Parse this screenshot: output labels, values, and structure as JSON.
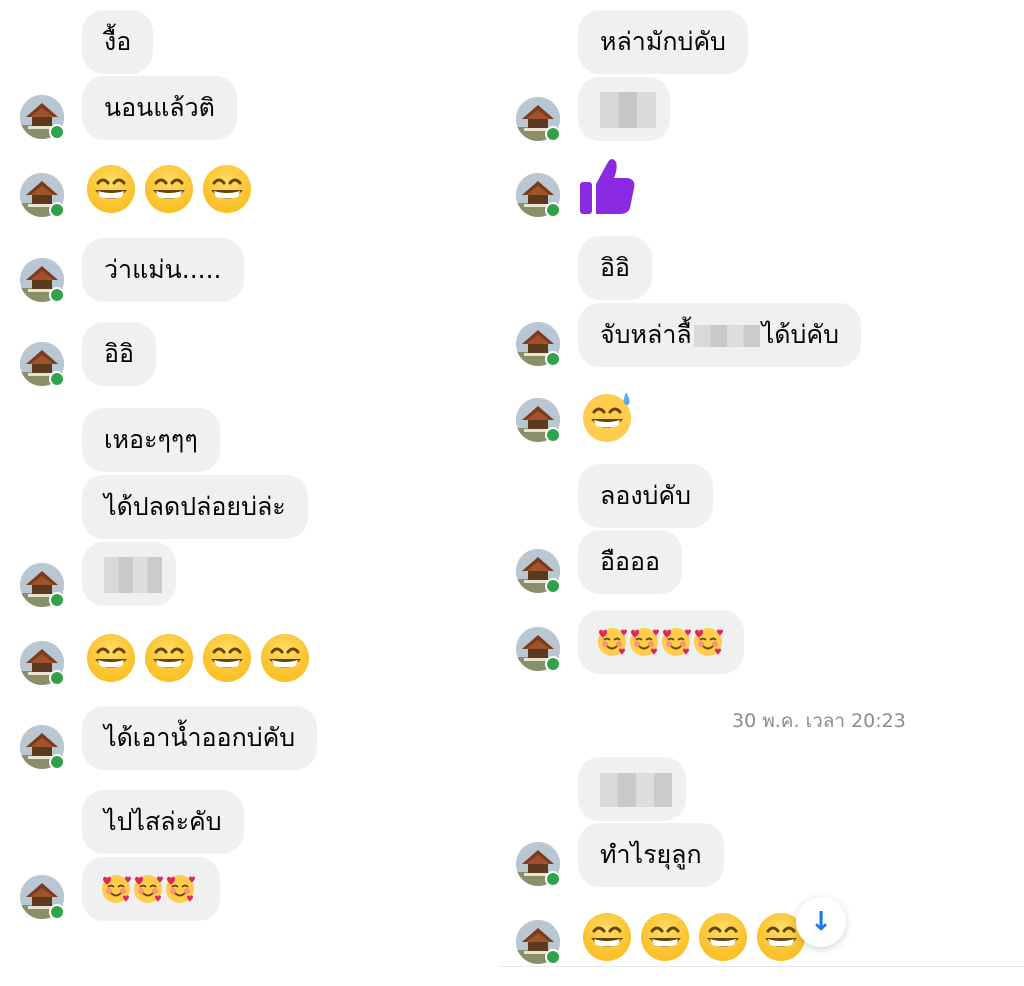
{
  "left": {
    "messages": [
      {
        "text": "งื้อ"
      },
      {
        "text": "นอนแล้วติ"
      },
      {
        "emoji": "grinning-face",
        "count": 3
      },
      {
        "text": "ว่าแม่น....."
      },
      {
        "text": "อิอิ"
      },
      {
        "text": "เหอะๆๆๆ"
      },
      {
        "text": "ได้ปลดปล่อยบ่ล่ะ"
      },
      {
        "redacted": true
      },
      {
        "emoji": "grinning-face",
        "count": 4
      },
      {
        "text": "ได้เอาน้ำออกบ่คับ"
      },
      {
        "text": "ไปไสล่ะคับ"
      },
      {
        "emoji": "smiling-face-with-hearts",
        "count": 3
      }
    ]
  },
  "right": {
    "messages": [
      {
        "text": "หล่ามักบ่คับ"
      },
      {
        "redacted": true
      },
      {
        "emoji": "thumbs-up"
      },
      {
        "text": "อิอิ"
      },
      {
        "text_before": "จับหล่าลื้",
        "text_after": "ได้บ่คับ"
      },
      {
        "emoji": "grinning-face-with-sweat"
      },
      {
        "text": "ลองบ่คับ"
      },
      {
        "text": "อือออ"
      },
      {
        "emoji": "smiling-face-with-hearts",
        "count": 4
      },
      {
        "redacted": true
      },
      {
        "text": "ทำไรยุลูก"
      },
      {
        "emoji": "grinning-face",
        "count": 4
      }
    ],
    "timestamp": "30 พ.ค. เวลา 20:23"
  },
  "colors": {
    "bubble": "#f0f0f0",
    "online": "#31a24c",
    "thumb": "#8a2be2",
    "scroll_button_arrow": "#1877f2",
    "timestamp": "#8a8d91"
  },
  "icons": {
    "scroll_down": "↓"
  }
}
